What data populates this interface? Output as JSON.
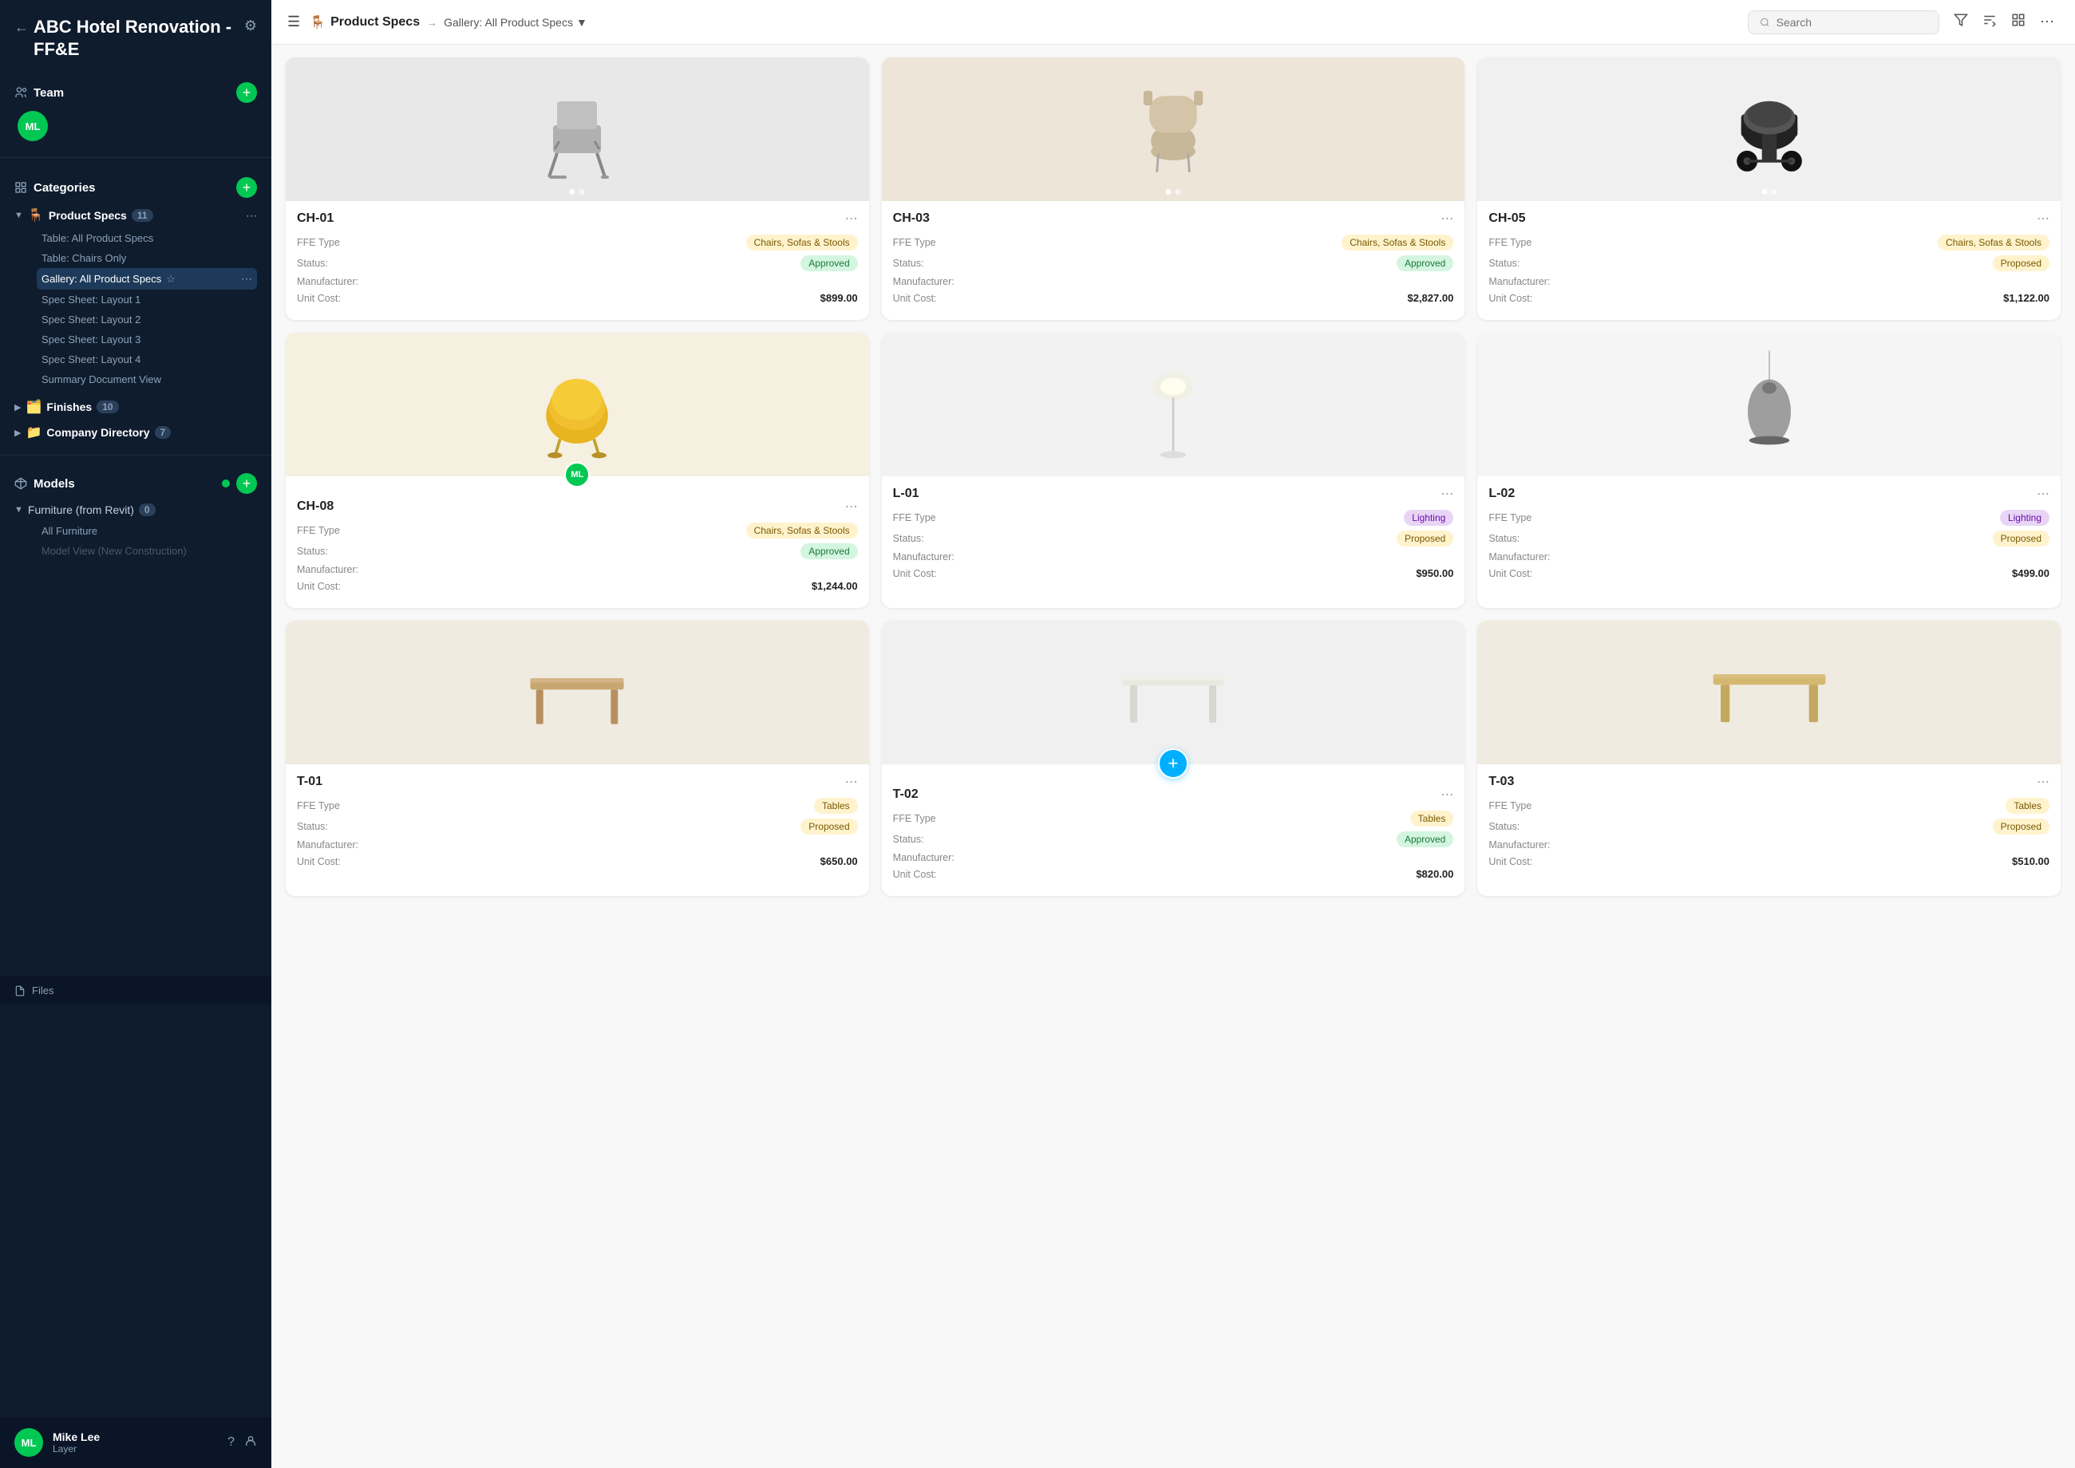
{
  "app": {
    "project_title": "ABC Hotel Renovation - FF&E"
  },
  "sidebar": {
    "team_label": "Team",
    "team_avatar": "ML",
    "categories_label": "Categories",
    "product_specs": {
      "label": "Product Specs",
      "icon": "🪑",
      "count": 11,
      "sub_items": [
        {
          "id": "table-all",
          "label": "Table: All Product Specs",
          "active": false
        },
        {
          "id": "table-chairs",
          "label": "Table: Chairs Only",
          "active": false
        },
        {
          "id": "gallery-all",
          "label": "Gallery: All Product Specs",
          "active": true
        },
        {
          "id": "spec-1",
          "label": "Spec Sheet: Layout 1",
          "active": false
        },
        {
          "id": "spec-2",
          "label": "Spec Sheet: Layout 2",
          "active": false
        },
        {
          "id": "spec-3",
          "label": "Spec Sheet: Layout 3",
          "active": false
        },
        {
          "id": "spec-4",
          "label": "Spec Sheet: Layout 4",
          "active": false
        },
        {
          "id": "summary",
          "label": "Summary Document View",
          "active": false
        }
      ]
    },
    "finishes": {
      "label": "Finishes",
      "icon": "🗂️",
      "count": 10
    },
    "company_directory": {
      "label": "Company Directory",
      "icon": "📁",
      "count": 7
    },
    "models_label": "Models",
    "furniture_from_revit": {
      "label": "Furniture (from Revit)",
      "count": 0
    },
    "all_furniture": "All Furniture",
    "model_view": "Model View (New Construction)",
    "user": {
      "name": "Mike Lee",
      "role": "Layer",
      "avatar": "ML"
    },
    "files_label": "Files"
  },
  "topbar": {
    "page_icon": "🪑",
    "page_title": "Product Specs",
    "breadcrumb_current": "Gallery: All Product Specs",
    "search_placeholder": "Search",
    "filter_icon": "filter-icon",
    "sort_icon": "sort-icon",
    "view_icon": "view-icon",
    "more_icon": "more-icon"
  },
  "products": [
    {
      "id": "CH-01",
      "ffe_type": "Chairs, Sofas & Stools",
      "ffe_type_class": "chairs",
      "status": "Approved",
      "status_class": "approved",
      "manufacturer": "",
      "unit_cost": "$899.00",
      "image_type": "grey-chair",
      "dots": 2,
      "active_dot": 0,
      "show_avatar": false,
      "show_plus": false
    },
    {
      "id": "CH-03",
      "ffe_type": "Chairs, Sofas & Stools",
      "ffe_type_class": "chairs",
      "status": "Approved",
      "status_class": "approved",
      "manufacturer": "",
      "unit_cost": "$2,827.00",
      "image_type": "tan-chair",
      "dots": 2,
      "active_dot": 0,
      "show_avatar": false,
      "show_plus": false
    },
    {
      "id": "CH-05",
      "ffe_type": "Chairs, Sofas & Stools",
      "ffe_type_class": "chairs",
      "status": "Proposed",
      "status_class": "proposed",
      "manufacturer": "",
      "unit_cost": "$1,122.00",
      "image_type": "black-chair",
      "dots": 2,
      "active_dot": 0,
      "show_avatar": false,
      "show_plus": false
    },
    {
      "id": "CH-08",
      "ffe_type": "Chairs, Sofas & Stools",
      "ffe_type_class": "chairs",
      "status": "Approved",
      "status_class": "approved",
      "manufacturer": "",
      "unit_cost": "$1,244.00",
      "image_type": "yellow-chair",
      "dots": 1,
      "active_dot": 0,
      "show_avatar": true,
      "avatar_text": "ML",
      "show_plus": false
    },
    {
      "id": "L-01",
      "ffe_type": "Lighting",
      "ffe_type_class": "lighting",
      "status": "Proposed",
      "status_class": "proposed",
      "manufacturer": "",
      "unit_cost": "$950.00",
      "image_type": "floor-lamp",
      "dots": 0,
      "active_dot": 0,
      "show_avatar": false,
      "show_plus": false
    },
    {
      "id": "L-02",
      "ffe_type": "Lighting",
      "ffe_type_class": "lighting",
      "status": "Proposed",
      "status_class": "proposed",
      "manufacturer": "",
      "unit_cost": "$499.00",
      "image_type": "pendant-lamp",
      "dots": 0,
      "active_dot": 0,
      "show_avatar": false,
      "show_plus": false
    },
    {
      "id": "T-01",
      "ffe_type": "Tables",
      "ffe_type_class": "chairs",
      "status": "Proposed",
      "status_class": "proposed",
      "manufacturer": "",
      "unit_cost": "$650.00",
      "image_type": "wood-table-1",
      "dots": 0,
      "active_dot": 0,
      "show_avatar": false,
      "show_plus": false
    },
    {
      "id": "T-02",
      "ffe_type": "Tables",
      "ffe_type_class": "chairs",
      "status": "Approved",
      "status_class": "approved",
      "manufacturer": "",
      "unit_cost": "$820.00",
      "image_type": "white-table",
      "dots": 0,
      "active_dot": 0,
      "show_avatar": false,
      "show_plus": true
    },
    {
      "id": "T-03",
      "ffe_type": "Tables",
      "ffe_type_class": "chairs",
      "status": "Proposed",
      "status_class": "proposed",
      "manufacturer": "",
      "unit_cost": "$510.00",
      "image_type": "wood-table-2",
      "dots": 0,
      "active_dot": 0,
      "show_avatar": false,
      "show_plus": false
    }
  ],
  "labels": {
    "ffe_type": "FFE Type",
    "status": "Status:",
    "manufacturer": "Manufacturer:",
    "unit_cost": "Unit Cost:",
    "add_button": "+",
    "plus_button": "+"
  }
}
